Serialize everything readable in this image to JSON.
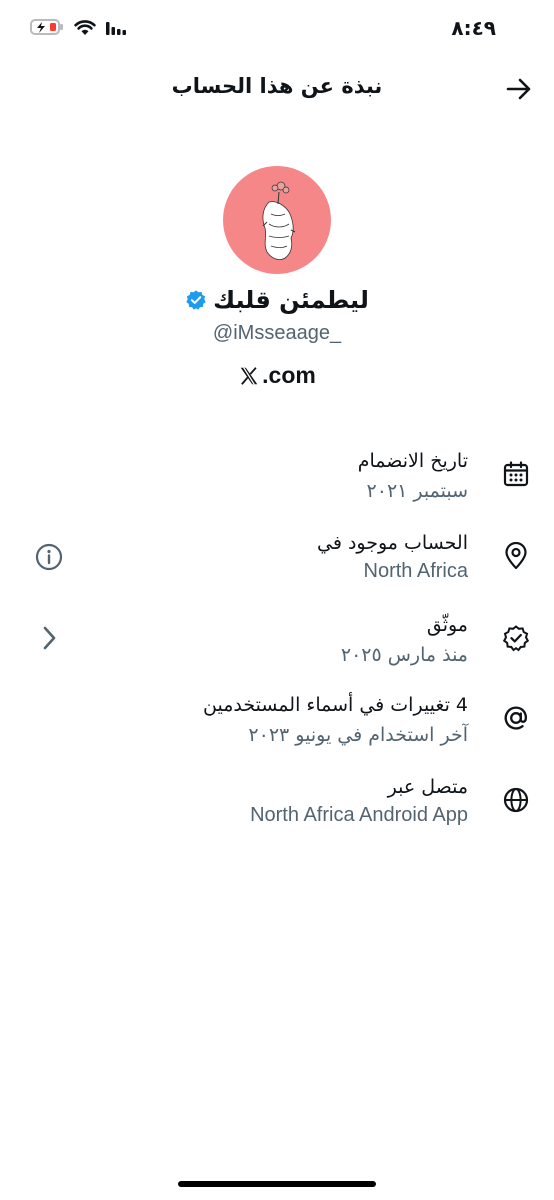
{
  "status_bar": {
    "time": "٨:٤٩"
  },
  "header": {
    "title": "نبذة عن هذا الحساب"
  },
  "profile": {
    "display_name": "ليطمئن قلبك",
    "handle": "@iMsseaage_",
    "site_domain": ".com",
    "avatar_color": "#f58789"
  },
  "rows": [
    {
      "label": "تاريخ الانضمام",
      "value": "سبتمبر ٢٠٢١",
      "icon": "calendar-icon"
    },
    {
      "label": "الحساب موجود في",
      "value": "North Africa",
      "icon": "location-pin-icon",
      "side_icon": "info-icon"
    },
    {
      "label": "موثّق",
      "value": "منذ مارس ٢٠٢٥",
      "icon": "verified-badge-icon",
      "side_icon": "chevron-right-icon"
    },
    {
      "label": "4 تغييرات في أسماء المستخدمين",
      "value": "آخر استخدام في يونيو ٢٠٢٣",
      "icon": "at-sign-icon"
    },
    {
      "label": "متصل عبر",
      "value": "North Africa Android App",
      "icon": "globe-icon"
    }
  ],
  "colors": {
    "verified": "#1d9bf0",
    "secondary_text": "#536471",
    "battery_low": "#ff3b30"
  }
}
